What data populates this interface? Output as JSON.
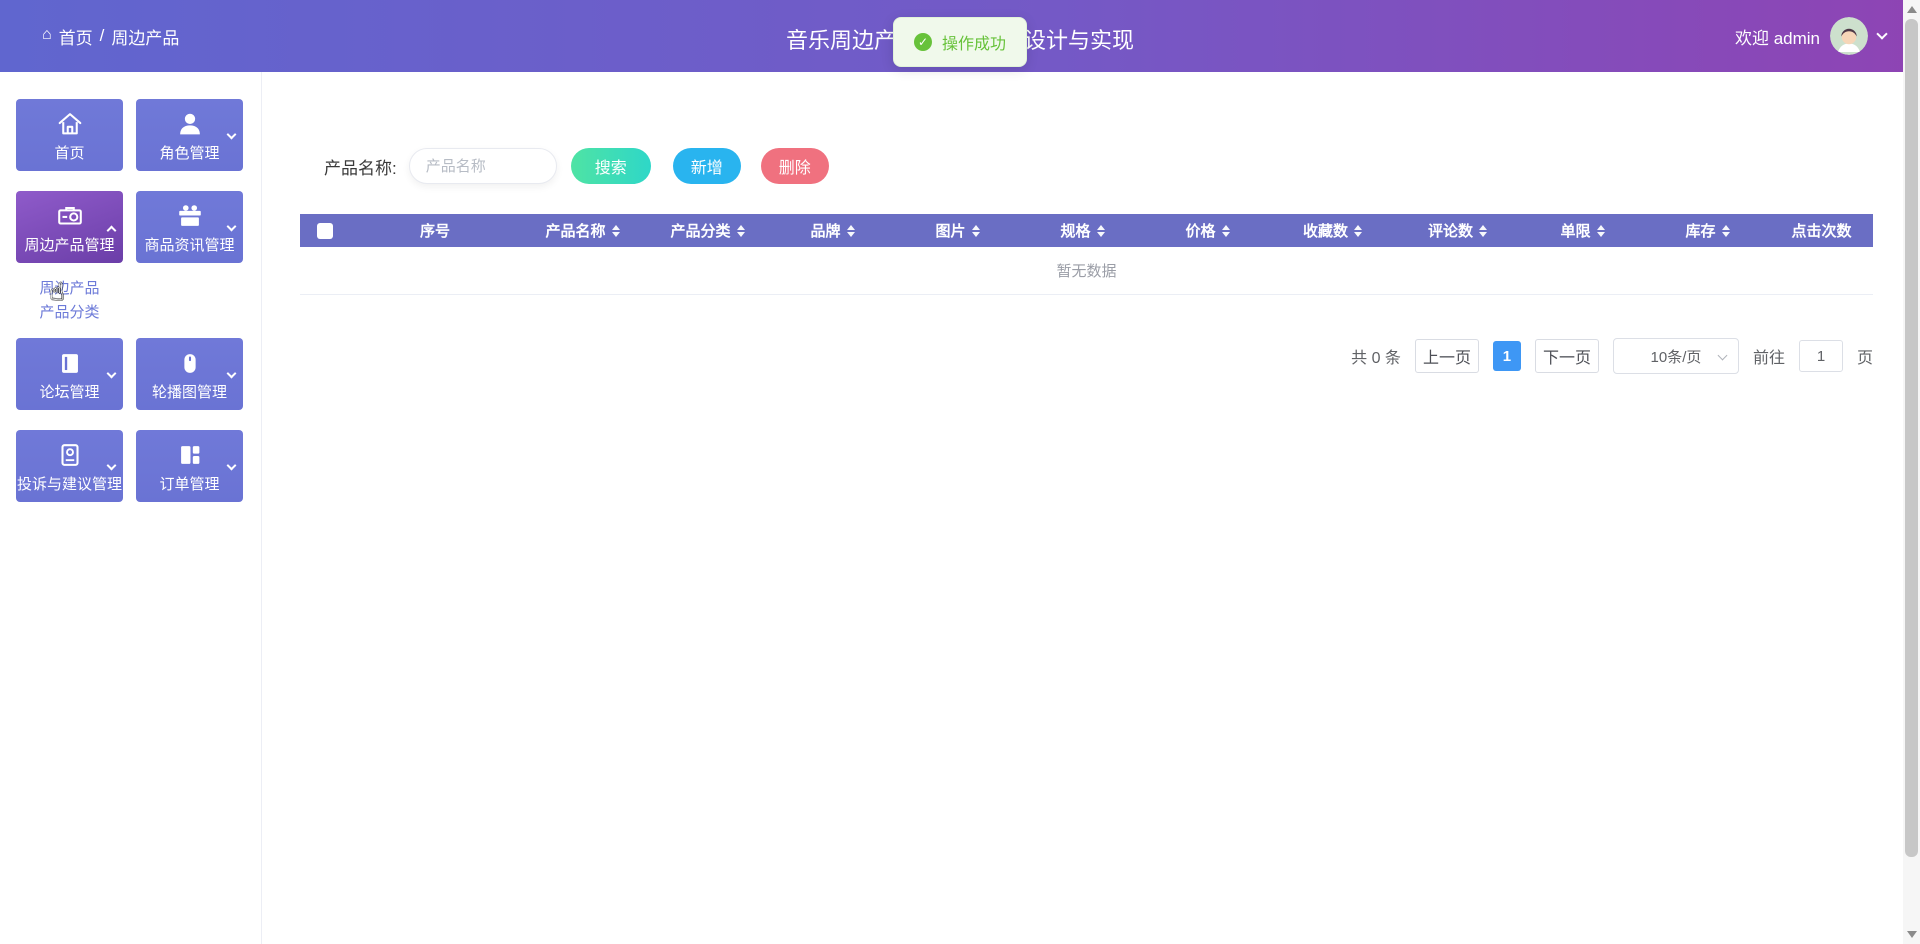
{
  "header": {
    "breadcrumb_home": "首页",
    "breadcrumb_sep": "/",
    "breadcrumb_current": "周边产品",
    "title_left": "音乐周边产",
    "title_right": "设计与实现",
    "welcome": "欢迎 admin"
  },
  "toast": {
    "message": "操作成功",
    "status_color": "#67c23a"
  },
  "sidebar": {
    "tiles": [
      {
        "label": "首页",
        "icon": "home-icon"
      },
      {
        "label": "角色管理",
        "icon": "user-icon"
      },
      {
        "label": "周边产品管理",
        "icon": "product-icon",
        "active": true,
        "expanded": true
      },
      {
        "label": "商品资讯管理",
        "icon": "gift-icon"
      },
      {
        "label": "论坛管理",
        "icon": "forum-icon"
      },
      {
        "label": "轮播图管理",
        "icon": "carousel-icon"
      },
      {
        "label": "投诉与建议管理",
        "icon": "complaint-icon"
      },
      {
        "label": "订单管理",
        "icon": "order-icon"
      }
    ],
    "submenu": [
      {
        "label": "周边产品",
        "active": true
      },
      {
        "label": "产品分类"
      }
    ]
  },
  "search": {
    "label": "产品名称:",
    "placeholder": "产品名称",
    "search_btn": "搜索",
    "add_btn": "新增",
    "delete_btn": "删除"
  },
  "table": {
    "columns": [
      "序号",
      "产品名称",
      "产品分类",
      "品牌",
      "图片",
      "规格",
      "价格",
      "收藏数",
      "评论数",
      "单限",
      "库存",
      "点击次数"
    ],
    "empty_text": "暂无数据"
  },
  "pagination": {
    "total": "共 0 条",
    "prev": "上一页",
    "current_page": "1",
    "next": "下一页",
    "page_size": "10条/页",
    "goto_label": "前往",
    "goto_value": "1",
    "goto_unit": "页"
  },
  "colors": {
    "header_gradient_start": "#6066cf",
    "header_gradient_end": "#8e44b4",
    "tile_purple": "#6d76d6",
    "active_tile_purple": "#7b4bb4",
    "table_header": "#6a6ec4",
    "success_green": "#67c23a",
    "search_button_teal": "#3bddb6",
    "add_button_blue": "#29b4ef",
    "delete_button_pink": "#f0717f",
    "active_page_blue": "#3e97f5"
  }
}
